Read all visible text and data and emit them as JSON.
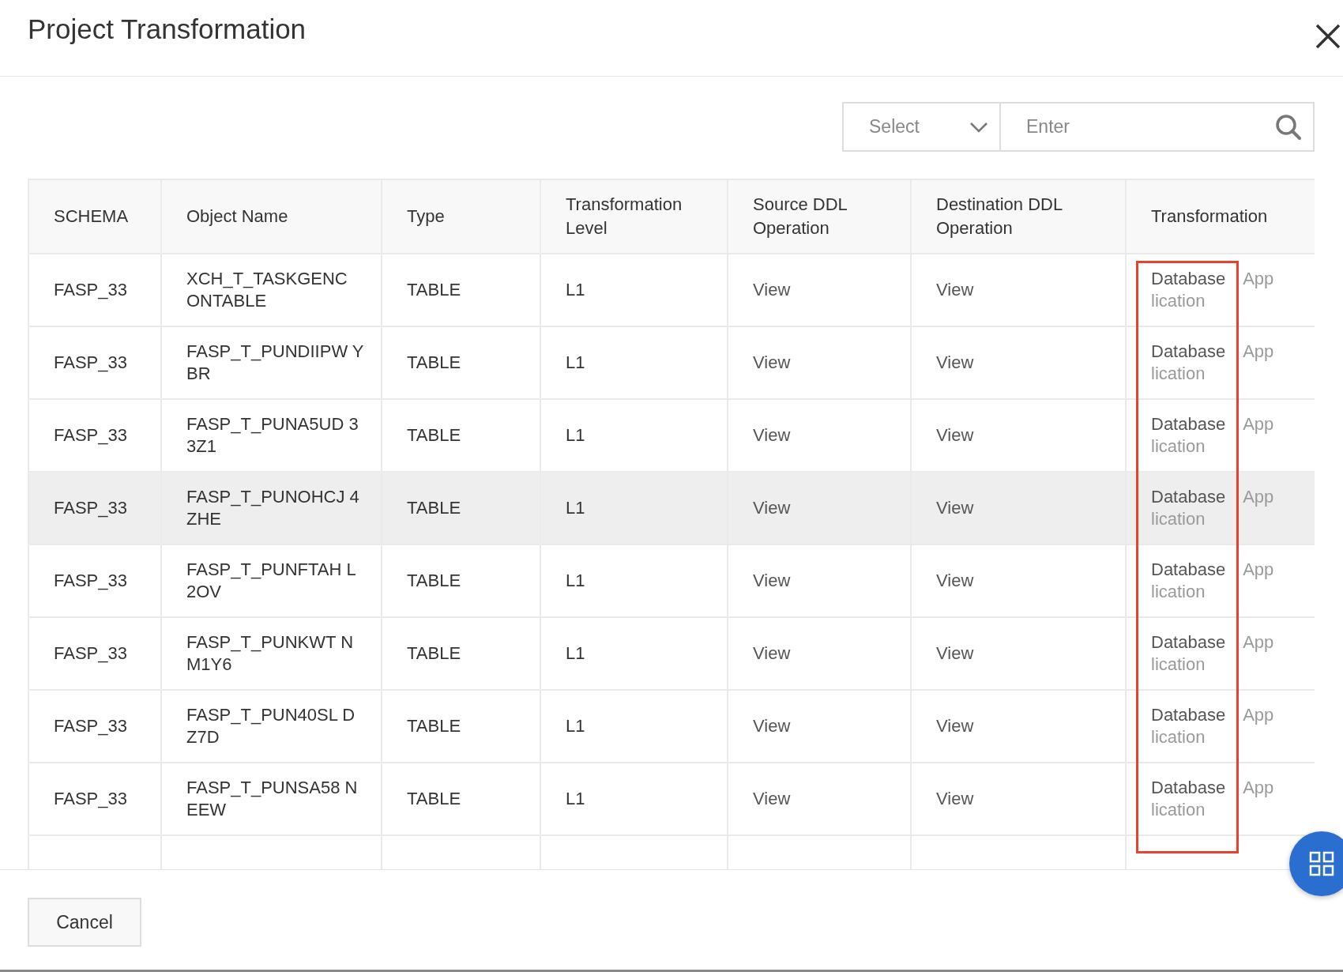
{
  "dialog": {
    "title": "Project Transformation"
  },
  "filter": {
    "select_placeholder": "Select",
    "search_placeholder": "Enter"
  },
  "table": {
    "columns": [
      "SCHEMA",
      "Object Name",
      "Type",
      "Transformation Level",
      "Source DDL Operation",
      "Destination DDL Operation",
      "Transformation"
    ],
    "transformation_column_framed": true,
    "rows": [
      {
        "schema": "FASP_33",
        "object_name": "XCH_T_TASKGENC ONTABLE",
        "type": "TABLE",
        "level": "L1",
        "source_ddl": "View",
        "destination_ddl": "View",
        "transformation": [
          {
            "label": "Database",
            "disabled": false
          },
          {
            "label": "Application",
            "disabled": true
          }
        ],
        "hovered": false
      },
      {
        "schema": "FASP_33",
        "object_name": "FASP_T_PUNDIIPW YBR",
        "type": "TABLE",
        "level": "L1",
        "source_ddl": "View",
        "destination_ddl": "View",
        "transformation": [
          {
            "label": "Database",
            "disabled": false
          },
          {
            "label": "Application",
            "disabled": true
          }
        ],
        "hovered": false
      },
      {
        "schema": "FASP_33",
        "object_name": "FASP_T_PUNA5UD 33Z1",
        "type": "TABLE",
        "level": "L1",
        "source_ddl": "View",
        "destination_ddl": "View",
        "transformation": [
          {
            "label": "Database",
            "disabled": false
          },
          {
            "label": "Application",
            "disabled": true
          }
        ],
        "hovered": false
      },
      {
        "schema": "FASP_33",
        "object_name": "FASP_T_PUNOHCJ 4ZHE",
        "type": "TABLE",
        "level": "L1",
        "source_ddl": "View",
        "destination_ddl": "View",
        "transformation": [
          {
            "label": "Database",
            "disabled": false
          },
          {
            "label": "Application",
            "disabled": true
          }
        ],
        "hovered": true
      },
      {
        "schema": "FASP_33",
        "object_name": "FASP_T_PUNFTAH L2OV",
        "type": "TABLE",
        "level": "L1",
        "source_ddl": "View",
        "destination_ddl": "View",
        "transformation": [
          {
            "label": "Database",
            "disabled": false
          },
          {
            "label": "Application",
            "disabled": true
          }
        ],
        "hovered": false
      },
      {
        "schema": "FASP_33",
        "object_name": "FASP_T_PUNKWT NM1Y6",
        "type": "TABLE",
        "level": "L1",
        "source_ddl": "View",
        "destination_ddl": "View",
        "transformation": [
          {
            "label": "Database",
            "disabled": false
          },
          {
            "label": "Application",
            "disabled": true
          }
        ],
        "hovered": false
      },
      {
        "schema": "FASP_33",
        "object_name": "FASP_T_PUN40SL DZ7D",
        "type": "TABLE",
        "level": "L1",
        "source_ddl": "View",
        "destination_ddl": "View",
        "transformation": [
          {
            "label": "Database",
            "disabled": false
          },
          {
            "label": "Application",
            "disabled": true
          }
        ],
        "hovered": false
      },
      {
        "schema": "FASP_33",
        "object_name": "FASP_T_PUNSA58 NEEW",
        "type": "TABLE",
        "level": "L1",
        "source_ddl": "View",
        "destination_ddl": "View",
        "transformation": [
          {
            "label": "Database",
            "disabled": false
          },
          {
            "label": "Application",
            "disabled": true
          }
        ],
        "hovered": false
      }
    ]
  },
  "footer": {
    "buttons": [
      "Cancel"
    ]
  }
}
